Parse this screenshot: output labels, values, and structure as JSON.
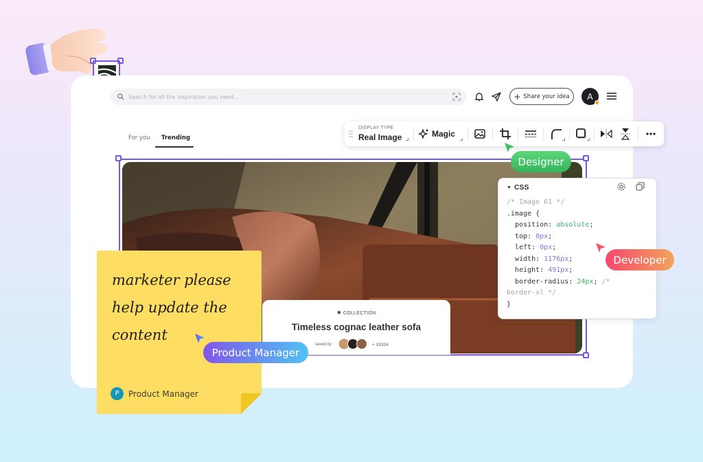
{
  "header": {
    "search_placeholder": "Search for all the inspiration you need...",
    "share_button_label": "Share your idea",
    "avatar_initial": "A",
    "icons": [
      "search-icon",
      "image-scan-icon",
      "bell-icon",
      "send-icon",
      "plus-icon",
      "hamburger-menu-icon"
    ]
  },
  "tabs": [
    {
      "label": "For you",
      "active": false
    },
    {
      "label": "Trending",
      "active": true
    }
  ],
  "toolbar": {
    "display_type_label": "DISPLAY TYPE",
    "display_type_value": "Real Image",
    "magic_label": "Magic",
    "icons": [
      "drag-grip-icon",
      "sparkle-icon",
      "image-icon",
      "crop-icon",
      "border-style-icon",
      "corner-radius-icon",
      "shadow-icon",
      "flip-horizontal-icon",
      "flip-vertical-icon",
      "more-icon"
    ]
  },
  "collection_card": {
    "label": "COLLECTION",
    "title": "Timeless cognac leather sofa",
    "saved_by_label": "saved by",
    "saved_count": "+ 15324"
  },
  "sticky_note": {
    "lines": [
      "marketer please",
      "help update the",
      "content"
    ],
    "author_initial": "P",
    "author_name": "Product Manager"
  },
  "cursor_tags": {
    "designer": "Designer",
    "developer": "Developer",
    "product_manager": "Product Manager"
  },
  "colors": {
    "selection": "#7757e6",
    "designer": "#3bbf62",
    "developer": "#f4506a",
    "product_manager": "#8256ea",
    "sticky": "#fdde62"
  },
  "css_panel": {
    "title": "CSS",
    "comment": "/* Image 61 */",
    "selector": ".image {",
    "props": [
      {
        "name": "position",
        "value": "absolute",
        "kind": "str"
      },
      {
        "name": "top",
        "value": "0px",
        "kind": "num"
      },
      {
        "name": "left",
        "value": "0px",
        "kind": "num"
      },
      {
        "name": "width",
        "value": "1176px",
        "kind": "num"
      },
      {
        "name": "height",
        "value": "491px",
        "kind": "num"
      },
      {
        "name": "border-radius",
        "value": "24px",
        "kind": "str"
      }
    ],
    "trailing_comment_a": "/*",
    "trailing_comment_b": "border-xl */",
    "closing": "}"
  }
}
